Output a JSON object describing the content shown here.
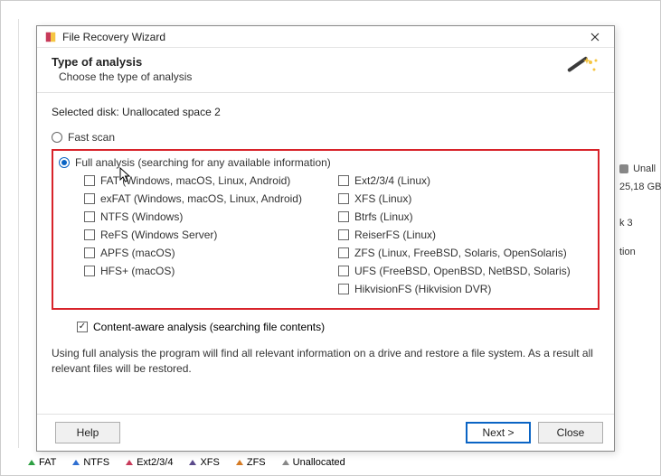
{
  "dialog": {
    "title": "File Recovery Wizard",
    "header_title": "Type of analysis",
    "header_sub": "Choose the type of analysis",
    "selected_disk_label": "Selected disk: Unallocated space 2",
    "fast_scan_label": "Fast scan",
    "full_analysis_label": "Full analysis (searching for any available information)",
    "content_aware_label": "Content-aware analysis (searching file contents)",
    "info_text": "Using full analysis the program will find all relevant information on a drive and restore a file system. As a result all relevant files will be restored.",
    "radios": {
      "fast_scan_checked": false,
      "full_analysis_checked": true
    },
    "content_aware_checked": true,
    "filesystems_left": [
      "FAT (Windows, macOS, Linux, Android)",
      "exFAT (Windows, macOS, Linux, Android)",
      "NTFS (Windows)",
      "ReFS (Windows Server)",
      "APFS (macOS)",
      "HFS+ (macOS)"
    ],
    "filesystems_right": [
      "Ext2/3/4 (Linux)",
      "XFS (Linux)",
      "Btrfs (Linux)",
      "ReiserFS (Linux)",
      "ZFS (Linux, FreeBSD, Solaris, OpenSolaris)",
      "UFS (FreeBSD, OpenBSD, NetBSD, Solaris)",
      "HikvisionFS (Hikvision DVR)"
    ],
    "buttons": {
      "help": "Help",
      "next": "Next >",
      "close": "Close"
    }
  },
  "background": {
    "unall_label": "Unall",
    "unall_size": "25,18 GB",
    "k3_label": "k 3",
    "tion_label": "tion",
    "legend": [
      {
        "label": "FAT",
        "color": "#2ea043"
      },
      {
        "label": "NTFS",
        "color": "#2f6fd1"
      },
      {
        "label": "Ext2/3/4",
        "color": "#c73a5a"
      },
      {
        "label": "XFS",
        "color": "#5a4a8a"
      },
      {
        "label": "ZFS",
        "color": "#d47a24"
      },
      {
        "label": "Unallocated",
        "color": "#888888"
      }
    ]
  }
}
